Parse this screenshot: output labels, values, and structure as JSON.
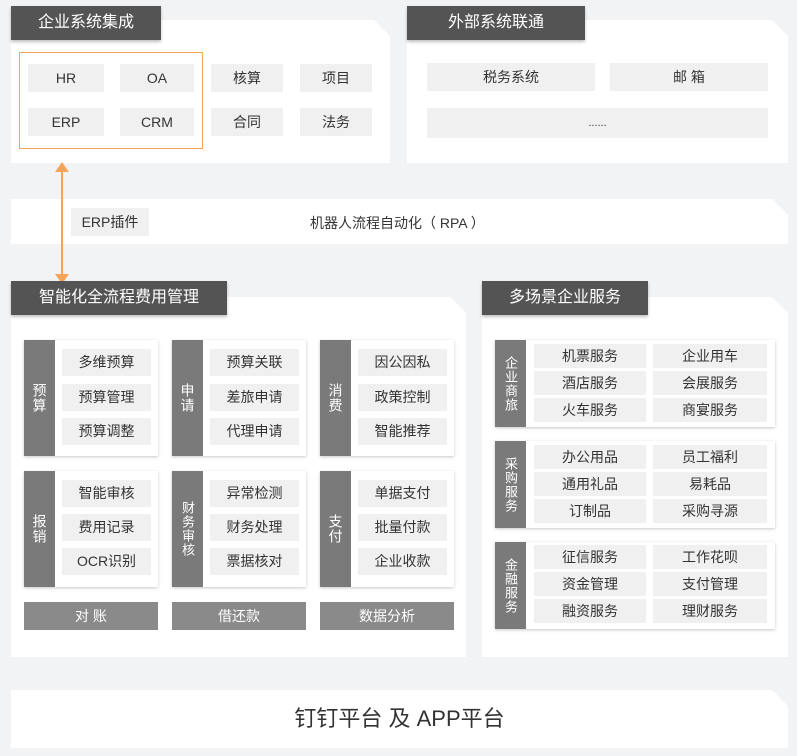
{
  "top_left": {
    "title": "企业系统集成",
    "items": [
      "HR",
      "OA",
      "ERP",
      "CRM",
      "核算",
      "项目",
      "合同",
      "法务"
    ]
  },
  "top_right": {
    "title": "外部系统联通",
    "items": [
      "税务系统",
      "邮 箱",
      "......"
    ]
  },
  "rpa_bar": {
    "plugin": "ERP插件",
    "label": "机器人流程自动化（ RPA ）"
  },
  "expense": {
    "title": "智能化全流程费用管理",
    "groups": [
      {
        "label": "预算",
        "items": [
          "多维预算",
          "预算管理",
          "预算调整"
        ]
      },
      {
        "label": "申请",
        "items": [
          "预算关联",
          "差旅申请",
          "代理申请"
        ]
      },
      {
        "label": "消费",
        "items": [
          "因公因私",
          "政策控制",
          "智能推荐"
        ]
      },
      {
        "label": "报销",
        "items": [
          "智能审核",
          "费用记录",
          "OCR识别"
        ]
      },
      {
        "label": "财务审核",
        "items": [
          "异常检测",
          "财务处理",
          "票据核对"
        ]
      },
      {
        "label": "支付",
        "items": [
          "单据支付",
          "批量付款",
          "企业收款"
        ]
      }
    ],
    "bottom": [
      "对 账",
      "借还款",
      "数据分析"
    ]
  },
  "services": {
    "title": "多场景企业服务",
    "groups": [
      {
        "label": "企业商旅",
        "items": [
          "机票服务",
          "企业用车",
          "酒店服务",
          "会展服务",
          "火车服务",
          "商宴服务"
        ]
      },
      {
        "label": "采购服务",
        "items": [
          "办公用品",
          "员工福利",
          "通用礼品",
          "易耗品",
          "订制品",
          "采购寻源"
        ]
      },
      {
        "label": "金融服务",
        "items": [
          "征信服务",
          "工作花呗",
          "资金管理",
          "支付管理",
          "融资服务",
          "理财服务"
        ]
      }
    ]
  },
  "footer": {
    "label": "钉钉平台 及 APP平台"
  },
  "colors": {
    "dark_tag": "#545454",
    "vertical_label": "#7a7a7a",
    "accent_orange": "#f5a45a"
  }
}
